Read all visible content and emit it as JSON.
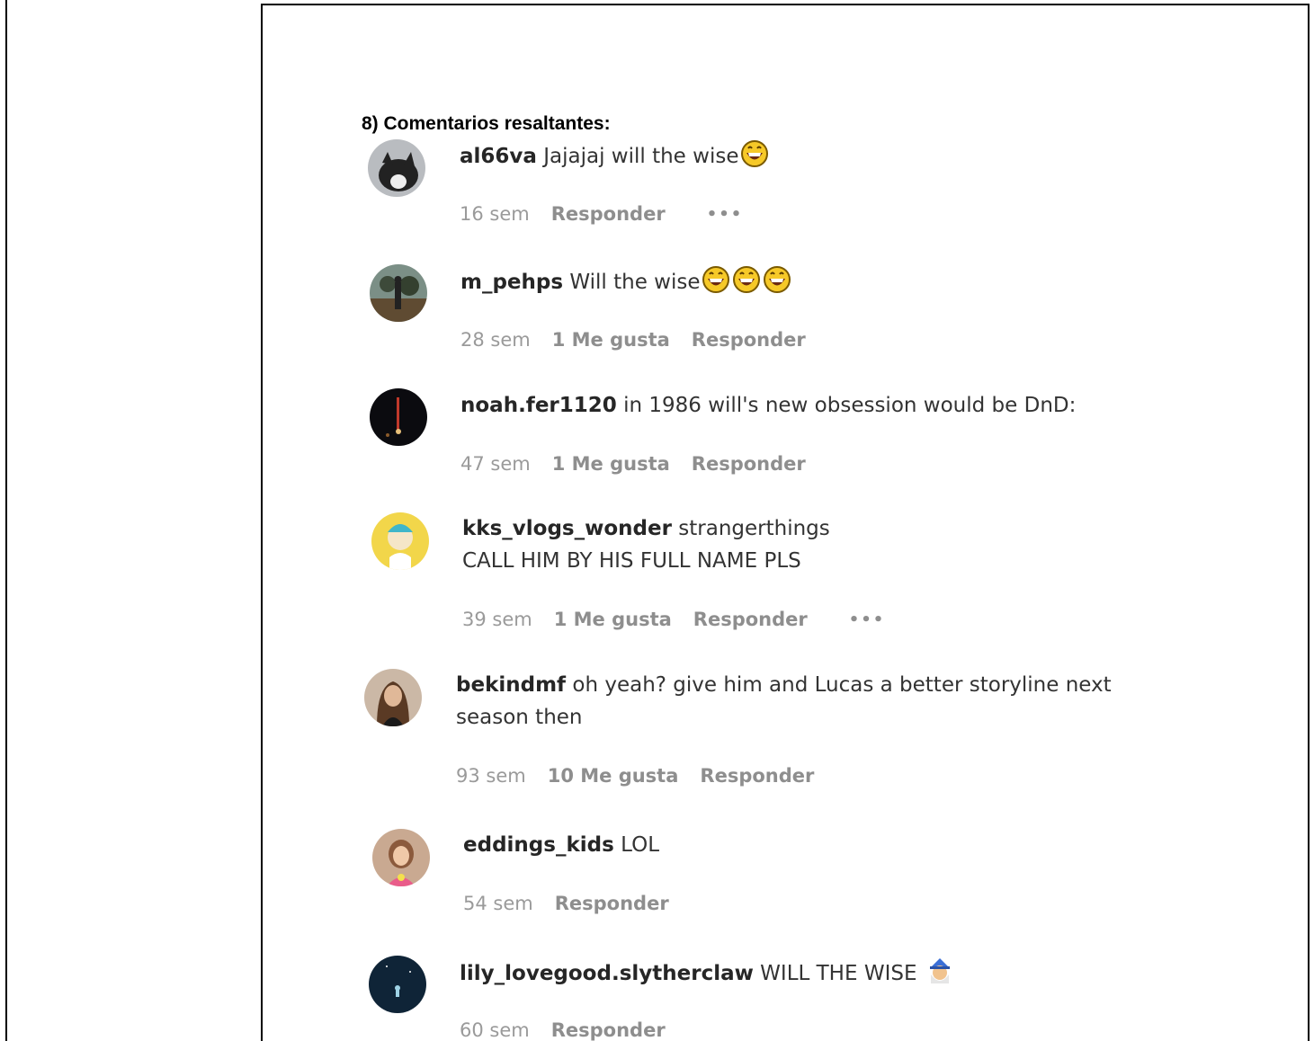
{
  "heading": "8) Comentarios resaltantes:",
  "comments": [
    {
      "user": "al66va",
      "text": "Jajajaj will the wise",
      "line2": "",
      "emojis": [
        "grinning-emoji"
      ],
      "time": "16 sem",
      "likes": "",
      "reply": "Responder",
      "more": "•••"
    },
    {
      "user": "m_pehps",
      "text": "Will the wise",
      "line2": "",
      "emojis": [
        "grinning-emoji",
        "grinning-emoji",
        "grinning-emoji"
      ],
      "time": "28 sem",
      "likes": "1 Me gusta",
      "reply": "Responder",
      "more": ""
    },
    {
      "user": "noah.fer1120",
      "text": "in 1986 will's new obsession would be DnD:",
      "line2": "",
      "emojis": [],
      "time": "47 sem",
      "likes": "1 Me gusta",
      "reply": "Responder",
      "more": ""
    },
    {
      "user": "kks_vlogs_wonder",
      "text": "strangerthings",
      "line2": "CALL HIM BY HIS FULL NAME PLS",
      "emojis": [],
      "time": "39 sem",
      "likes": "1 Me gusta",
      "reply": "Responder",
      "more": "•••"
    },
    {
      "user": "bekindmf",
      "text": "oh yeah? give him and Lucas a better storyline next",
      "line2": "season then",
      "emojis": [],
      "time": "93 sem",
      "likes": "10 Me gusta",
      "reply": "Responder",
      "more": ""
    },
    {
      "user": "eddings_kids",
      "text": "LOL",
      "line2": "",
      "emojis": [],
      "time": "54 sem",
      "likes": "",
      "reply": "Responder",
      "more": ""
    },
    {
      "user": "lily_lovegood.slytherclaw",
      "text": "WILL THE WISE",
      "line2": "",
      "emojis": [
        "wizard-emoji"
      ],
      "time": "60 sem",
      "likes": "",
      "reply": "Responder",
      "more": ""
    }
  ]
}
